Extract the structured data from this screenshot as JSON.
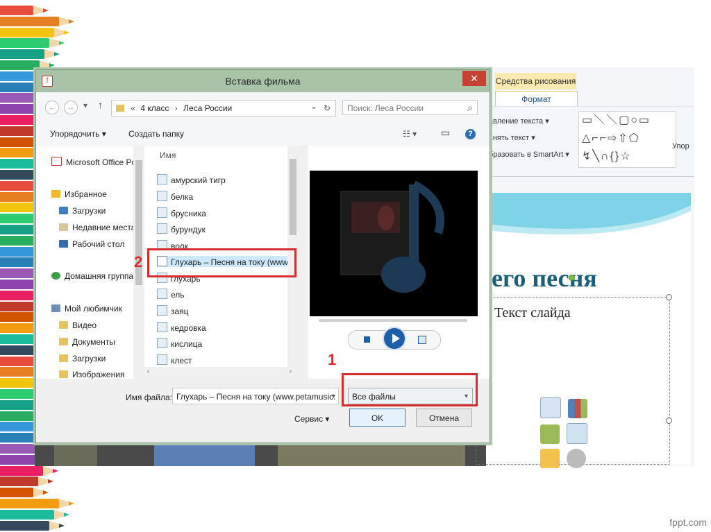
{
  "dialog": {
    "title": "Вставка фильма",
    "close": "✕",
    "nav": {
      "back": "←",
      "forward": "→",
      "recent": "▾",
      "up": "↑",
      "breadcrumb_prefix": "«",
      "breadcrumb": [
        "4 класс",
        "Леса России"
      ],
      "breadcrumb_sep": "›",
      "dropdown": "⌄",
      "refresh": "↻",
      "search_placeholder": "Поиск: Леса России",
      "search_icon": "⌕"
    },
    "toolbar": {
      "organize": "Упорядочить ▾",
      "new_folder": "Создать папку",
      "view_icon": "☷ ▾",
      "pane_icon": "▭",
      "help_icon": "?"
    },
    "nav_pane": {
      "items": [
        {
          "label": "Microsoft Office Po",
          "icon": "office-icon"
        },
        {
          "label": "Избранное",
          "icon": "star-icon"
        },
        {
          "label": "Загрузки",
          "icon": "downloads-icon"
        },
        {
          "label": "Недавние места",
          "icon": "recent-places-icon"
        },
        {
          "label": "Рабочий стол",
          "icon": "desktop-icon"
        },
        {
          "label": "Домашняя группа",
          "icon": "homegroup-icon"
        },
        {
          "label": "Мой любимчик",
          "icon": "computer-icon"
        },
        {
          "label": "Видео",
          "icon": "folder-icon"
        },
        {
          "label": "Документы",
          "icon": "folder-icon"
        },
        {
          "label": "Загрузки",
          "icon": "folder-icon"
        },
        {
          "label": "Изображения",
          "icon": "folder-icon"
        }
      ]
    },
    "file_list": {
      "column": "Имя",
      "files": [
        "амурский тигр",
        "белка",
        "брусника",
        "бурундук",
        "волк",
        "Глухарь – Песня на току (www.p",
        "глухарь",
        "ель",
        "заяц",
        "кедровка",
        "кислица",
        "клест"
      ],
      "selected_index": 5
    },
    "footer": {
      "filename_label": "Имя файла:",
      "filename_value": "Глухарь – Песня на току (www.petamusic.",
      "filetype": "Все файлы",
      "service": "Сервис ▾",
      "ok": "OK",
      "cancel": "Отмена"
    }
  },
  "annotations": {
    "marker1": "1",
    "marker2": "2",
    "color": "#d92d2d"
  },
  "ppt": {
    "context_tab": "Средства рисования",
    "format_tab": "Формат",
    "ribbon_items": [
      "авление текста ▾",
      "внять текст ▾",
      "бразовать в SmartArt ▾"
    ],
    "shapes_row1": "▭＼＼▢○▭",
    "shapes_row2": "△⌐⌐⇨⇧⬠",
    "shapes_row3": "↯╲∩{}☆",
    "ribbon_right": "Упор",
    "slide_title": "его песня",
    "slide_text": "Текст слайда"
  },
  "watermark": "fppt.com"
}
